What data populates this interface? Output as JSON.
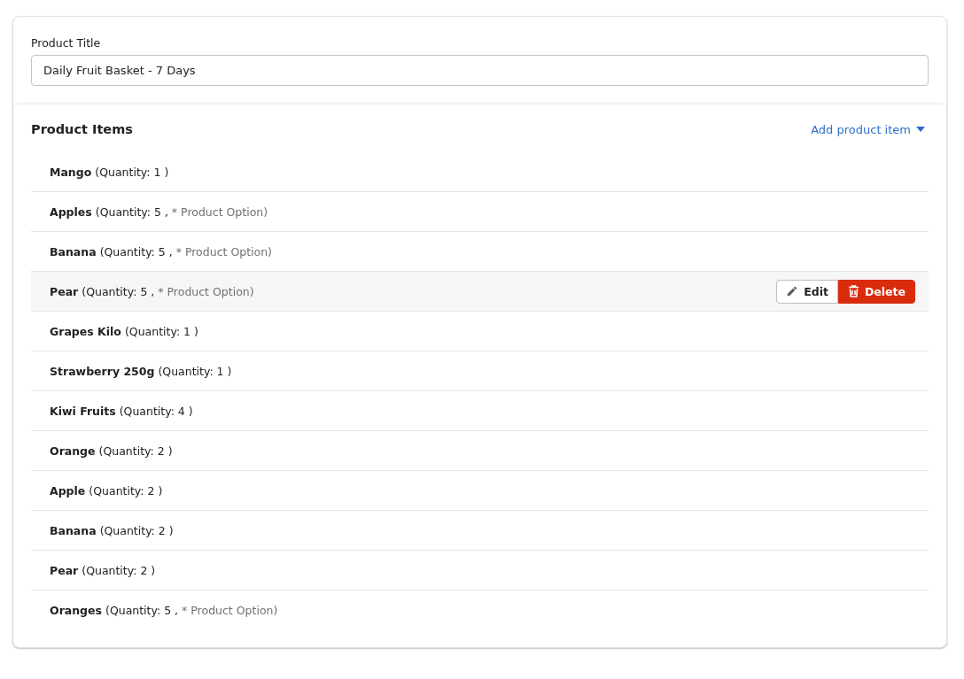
{
  "product_title": {
    "label": "Product Title",
    "value": "Daily Fruit Basket - 7 Days"
  },
  "product_items": {
    "title": "Product Items",
    "add_link": "Add product item",
    "actions": [
      "Edit",
      "Delete"
    ],
    "items": [
      {
        "name": "Mango",
        "quantity": "(Quantity: 1 )",
        "selected": false
      },
      {
        "name": "Apples",
        "quantity": "(Quantity: 5 ,",
        "option": "* Product Option)",
        "selected": false
      },
      {
        "name": "Banana",
        "quantity": "(Quantity: 5 ,",
        "option": "* Product Option)",
        "selected": false
      },
      {
        "name": "Pear",
        "quantity": "(Quantity: 5 ,",
        "option": "* Product Option)",
        "selected": true
      },
      {
        "name": "Grapes Kilo",
        "quantity": "(Quantity: 1 )",
        "selected": false
      },
      {
        "name": "Strawberry 250g",
        "quantity": "(Quantity: 1 )",
        "selected": false
      },
      {
        "name": "Kiwi Fruits",
        "quantity": "(Quantity: 4 )",
        "selected": false
      },
      {
        "name": "Orange",
        "quantity": "(Quantity: 2 )",
        "selected": false
      },
      {
        "name": "Apple",
        "quantity": "(Quantity: 2 )",
        "selected": false
      },
      {
        "name": "Banana",
        "quantity": "(Quantity: 2 )",
        "selected": false
      },
      {
        "name": "Pear",
        "quantity": "(Quantity: 2 )",
        "selected": false
      },
      {
        "name": "Oranges",
        "quantity": "(Quantity: 5 ,",
        "option": "* Product Option)",
        "selected": false
      }
    ]
  }
}
